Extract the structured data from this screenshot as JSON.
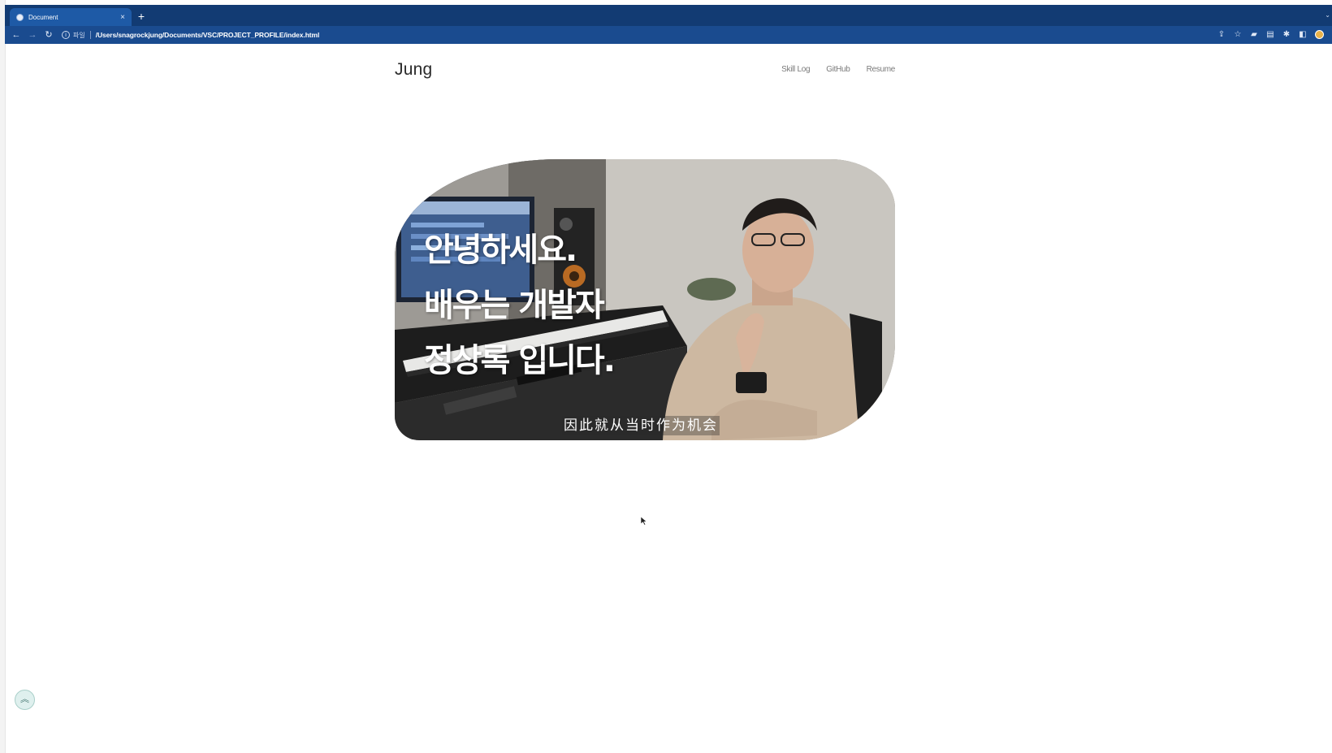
{
  "browser": {
    "tab_title": "Document",
    "tab_close": "×",
    "new_tab": "+",
    "address_scheme": "파일",
    "address_url": "/Users/snagrockjung/Documents/VSC/PROJECT_PROFILE/index.html",
    "accent_color": "#123b73"
  },
  "site": {
    "logo": "Jung",
    "nav": [
      "Skill Log",
      "GitHub",
      "Resume"
    ]
  },
  "hero": {
    "caption_lines": [
      "안녕하세요.",
      "배우는 개발자",
      "정상록 입니다."
    ],
    "subtitle": "因此就从当时作为机会"
  },
  "scroll_top": {
    "icon": "double-chevron-up-icon",
    "glyph": "⌃"
  }
}
